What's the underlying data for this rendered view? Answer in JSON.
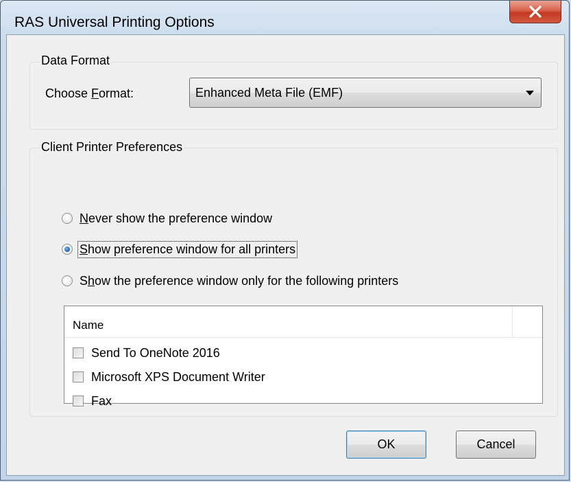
{
  "window": {
    "title": "RAS Universal Printing Options",
    "close_glyph": "X"
  },
  "data_format": {
    "group_label": "Data Format",
    "choose_label_pre": "Choose ",
    "choose_label_mnemonic": "F",
    "choose_label_post": "ormat:",
    "selected_format": "Enhanced Meta File (EMF)"
  },
  "client_printer": {
    "group_label": "Client Printer Preferences",
    "radios": [
      {
        "mnemonic": "N",
        "rest": "ever show the preference window",
        "checked": false
      },
      {
        "mnemonic": "S",
        "rest": "how preference window for all printers",
        "checked": true
      },
      {
        "pre": "S",
        "mnemonic": "h",
        "rest": "ow the preference window only for the following printers",
        "checked": false
      }
    ],
    "list": {
      "column_name": "Name",
      "items": [
        {
          "label": "Send To OneNote 2016",
          "checked": false
        },
        {
          "label": "Microsoft XPS Document Writer",
          "checked": false
        },
        {
          "label": "Fax",
          "checked": false
        }
      ]
    }
  },
  "buttons": {
    "ok": "OK",
    "cancel": "Cancel"
  },
  "colors": {
    "title_bar": "#cbdcee",
    "close_button": "#c23a21",
    "dialog_bg": "#f0f0f0",
    "focus_border": "#3c7fb1"
  }
}
